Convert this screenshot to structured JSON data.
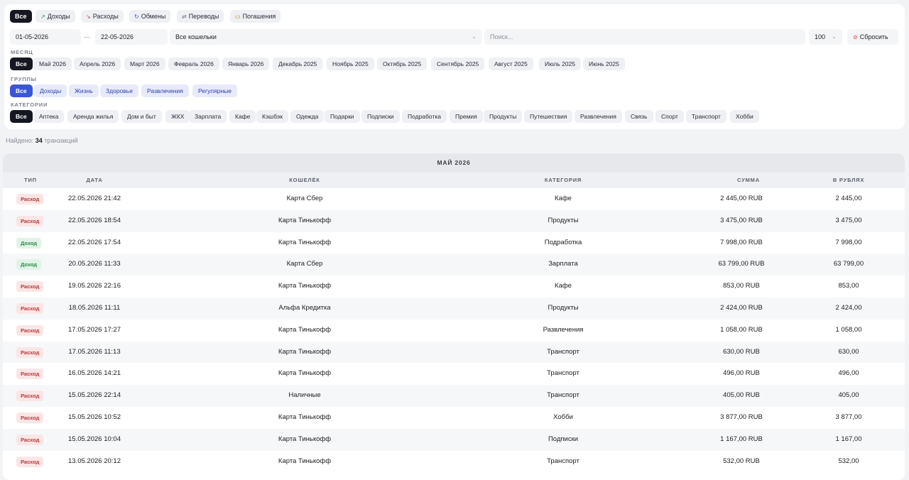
{
  "type_filters": [
    {
      "label": "Все",
      "icon": "none"
    },
    {
      "label": "Доходы",
      "icon": "trending-up-icon"
    },
    {
      "label": "Расходы",
      "icon": "trending-down-icon"
    },
    {
      "label": "Обмены",
      "icon": "refresh-icon"
    },
    {
      "label": "Переводы",
      "icon": "swap-icon"
    },
    {
      "label": "Погашения",
      "icon": "card-icon"
    }
  ],
  "date_from": "01-05-2026",
  "date_sep": "—",
  "date_to": "22-05-2026",
  "wallet_select": "Все кошельки",
  "search_placeholder": "Поиск...",
  "page_size": "100",
  "reset_label": "Сбросить",
  "month_label": "МЕСЯЦ",
  "months": [
    "Все",
    "Май 2026",
    "Апрель 2026",
    "Март 2026",
    "Февраль 2026",
    "Январь 2026",
    "Декабрь 2025",
    "Ноябрь 2025",
    "Октябрь 2025",
    "Сентябрь 2025",
    "Август 2025",
    "Июль 2025",
    "Июнь 2025"
  ],
  "groups_label": "ГРУППЫ",
  "groups": [
    "Все",
    "Доходы",
    "Жизнь",
    "Здоровье",
    "Развлечения",
    "Регулярные"
  ],
  "categories_label": "КАТЕГОРИИ",
  "categories": [
    "Все",
    "Аптека",
    "Аренда жилья",
    "Дом и быт",
    "ЖКХ",
    "Зарплата",
    "Кафе",
    "Кэшбэк",
    "Одежда",
    "Подарки",
    "Подписки",
    "Подработка",
    "Премия",
    "Продукты",
    "Путешествия",
    "Развлечения",
    "Связь",
    "Спорт",
    "Транспорт",
    "Хобби"
  ],
  "found": {
    "prefix": "Найдено:",
    "count": "34",
    "suffix": "транзакций"
  },
  "table": {
    "month_header": "МАЙ 2026",
    "columns": [
      "ТИП",
      "ДАТА",
      "КОШЕЛЁК",
      "КАТЕГОРИЯ",
      "СУММА",
      "В РУБЛЯХ"
    ],
    "rows": [
      {
        "type": "Расход",
        "kind": "exp",
        "date": "22.05.2026 21:42",
        "wallet": "Карта Сбер",
        "category": "Кафе",
        "amount": "2 445,00 RUB",
        "rub": "2 445,00"
      },
      {
        "type": "Расход",
        "kind": "exp",
        "date": "22.05.2026 18:54",
        "wallet": "Карта Тинькофф",
        "category": "Продукты",
        "amount": "3 475,00 RUB",
        "rub": "3 475,00"
      },
      {
        "type": "Доход",
        "kind": "inc",
        "date": "22.05.2026 17:54",
        "wallet": "Карта Тинькофф",
        "category": "Подработка",
        "amount": "7 998,00 RUB",
        "rub": "7 998,00"
      },
      {
        "type": "Доход",
        "kind": "inc",
        "date": "20.05.2026 11:33",
        "wallet": "Карта Сбер",
        "category": "Зарплата",
        "amount": "63 799,00 RUB",
        "rub": "63 799,00"
      },
      {
        "type": "Расход",
        "kind": "exp",
        "date": "19.05.2026 22:16",
        "wallet": "Карта Тинькофф",
        "category": "Кафе",
        "amount": "853,00 RUB",
        "rub": "853,00"
      },
      {
        "type": "Расход",
        "kind": "exp",
        "date": "18.05.2026 11:11",
        "wallet": "Альфа Кредитка",
        "category": "Продукты",
        "amount": "2 424,00 RUB",
        "rub": "2 424,00"
      },
      {
        "type": "Расход",
        "kind": "exp",
        "date": "17.05.2026 17:27",
        "wallet": "Карта Тинькофф",
        "category": "Развлечения",
        "amount": "1 058,00 RUB",
        "rub": "1 058,00"
      },
      {
        "type": "Расход",
        "kind": "exp",
        "date": "17.05.2026 11:13",
        "wallet": "Карта Тинькофф",
        "category": "Транспорт",
        "amount": "630,00 RUB",
        "rub": "630,00"
      },
      {
        "type": "Расход",
        "kind": "exp",
        "date": "16.05.2026 14:21",
        "wallet": "Карта Тинькофф",
        "category": "Транспорт",
        "amount": "496,00 RUB",
        "rub": "496,00"
      },
      {
        "type": "Расход",
        "kind": "exp",
        "date": "15.05.2026 22:14",
        "wallet": "Наличные",
        "category": "Транспорт",
        "amount": "405,00 RUB",
        "rub": "405,00"
      },
      {
        "type": "Расход",
        "kind": "exp",
        "date": "15.05.2026 10:52",
        "wallet": "Карта Тинькофф",
        "category": "Хобби",
        "amount": "3 877,00 RUB",
        "rub": "3 877,00"
      },
      {
        "type": "Расход",
        "kind": "exp",
        "date": "15.05.2026 10:04",
        "wallet": "Карта Тинькофф",
        "category": "Подписки",
        "amount": "1 167,00 RUB",
        "rub": "1 167,00"
      },
      {
        "type": "Расход",
        "kind": "exp",
        "date": "13.05.2026 20:12",
        "wallet": "Карта Тинькофф",
        "category": "Транспорт",
        "amount": "532,00 RUB",
        "rub": "532,00"
      }
    ]
  }
}
